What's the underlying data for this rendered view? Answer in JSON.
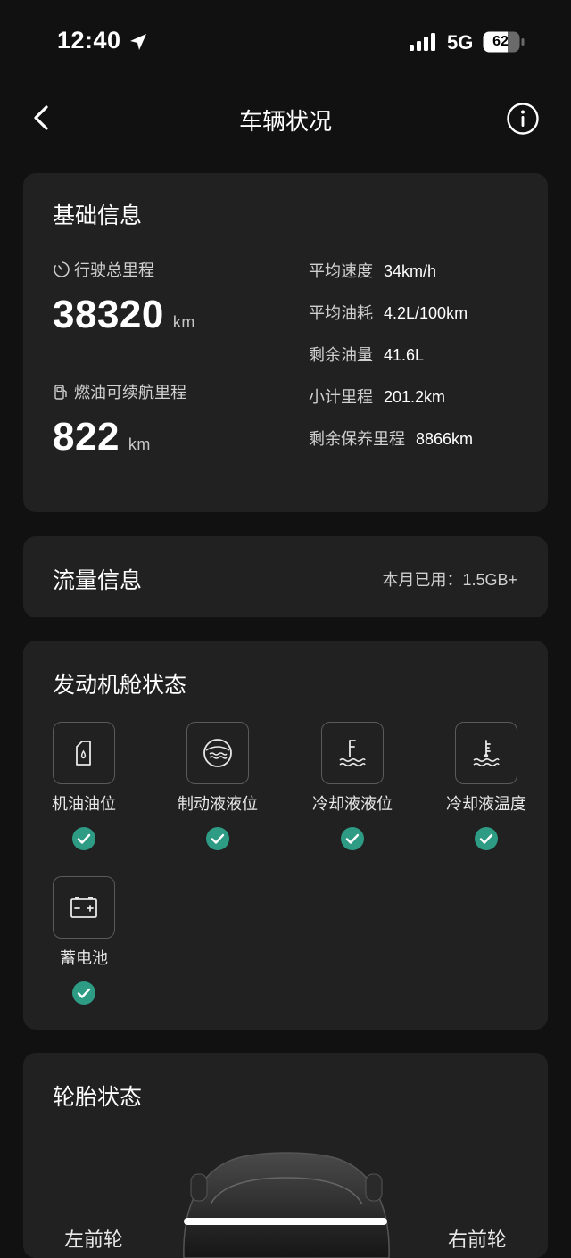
{
  "status_bar": {
    "time": "12:40",
    "network": "5G",
    "battery": "62"
  },
  "nav": {
    "title": "车辆状况"
  },
  "basic_info": {
    "title": "基础信息",
    "total_mileage": {
      "label": "行驶总里程",
      "value": "38320",
      "unit": "km"
    },
    "fuel_range": {
      "label": "燃油可续航里程",
      "value": "822",
      "unit": "km"
    },
    "stats": [
      {
        "label": "平均速度",
        "value": "34km/h"
      },
      {
        "label": "平均油耗",
        "value": "4.2L/100km"
      },
      {
        "label": "剩余油量",
        "value": "41.6L"
      },
      {
        "label": "小计里程",
        "value": "201.2km"
      },
      {
        "label": "剩余保养里程",
        "value": "8866km"
      }
    ]
  },
  "traffic": {
    "title": "流量信息",
    "usage": "本月已用：1.5GB+"
  },
  "engine": {
    "title": "发动机舱状态",
    "items": [
      {
        "label": "机油油位",
        "icon": "oil-level-icon",
        "status": "ok"
      },
      {
        "label": "制动液液位",
        "icon": "brake-fluid-icon",
        "status": "ok"
      },
      {
        "label": "冷却液液位",
        "icon": "coolant-level-icon",
        "status": "ok"
      },
      {
        "label": "冷却液温度",
        "icon": "coolant-temp-icon",
        "status": "ok"
      },
      {
        "label": "蓄电池",
        "icon": "battery-icon",
        "status": "ok"
      }
    ]
  },
  "tire": {
    "title": "轮胎状态",
    "left_front": "左前轮",
    "right_front": "右前轮"
  },
  "colors": {
    "background": "#111111",
    "card": "#212121",
    "check": "#2e9b84"
  }
}
